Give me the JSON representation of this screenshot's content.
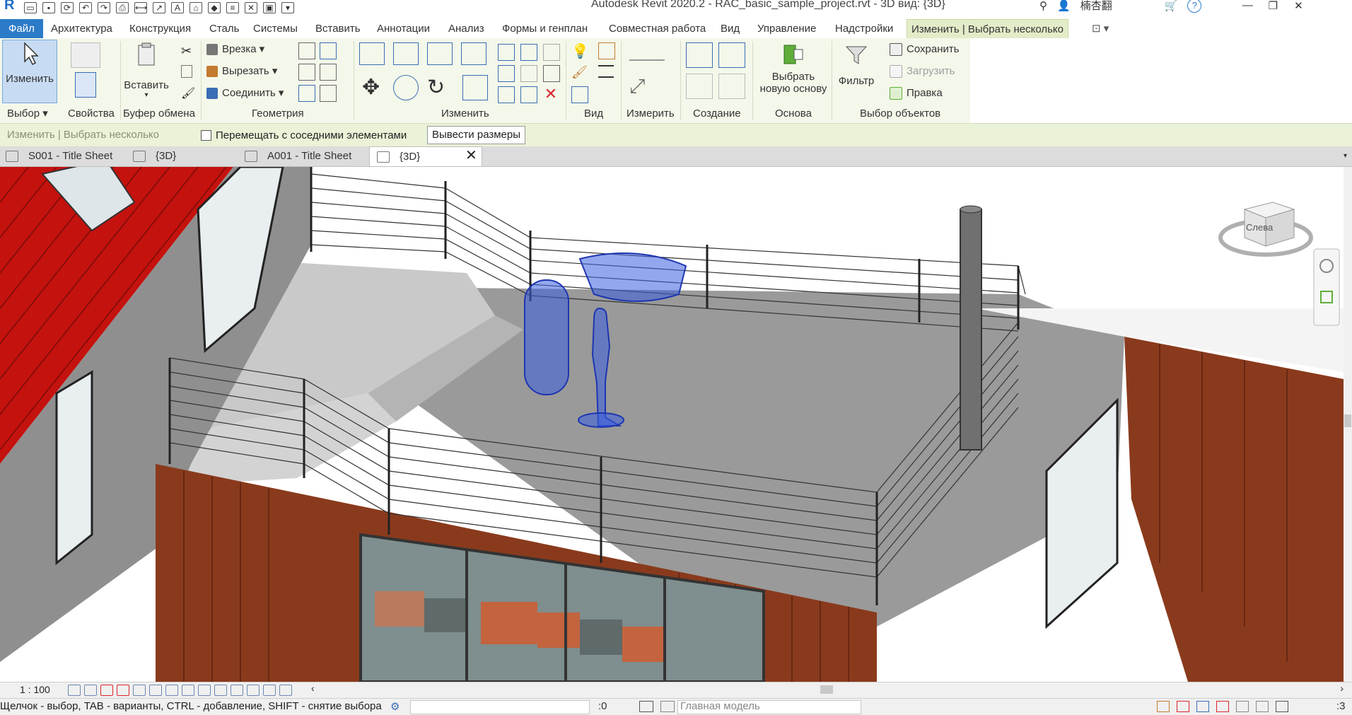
{
  "title_bar": {
    "app_title": "Autodesk Revit 2020.2 - RAC_basic_sample_project.rvt - 3D вид: {3D}",
    "user": "楠杏翻",
    "help": "?"
  },
  "menu": {
    "file": "Файл",
    "tabs": [
      "Архитектура",
      "Конструкция",
      "Сталь",
      "Системы",
      "Вставить",
      "Аннотации",
      "Анализ",
      "Формы и генплан",
      "Совместная работа",
      "Вид",
      "Управление",
      "Надстройки"
    ],
    "active_context_tab": "Изменить | Выбрать несколько"
  },
  "ribbon": {
    "modify_button": "Изменить",
    "panels": [
      "Выбор",
      "Свойства",
      "Буфер обмена",
      "Геометрия",
      "Изменить",
      "Вид",
      "Измерить",
      "Создание",
      "Основа",
      "Выбор объектов"
    ],
    "clipboard_paste": "Вставить",
    "geometry": {
      "cope": "Врезка",
      "cut": "Вырезать",
      "join": "Соединить"
    },
    "host": {
      "line1": "Выбрать",
      "line2": "новую основу"
    },
    "filter": "Фильтр",
    "selection": {
      "save": "Сохранить",
      "load": "Загрузить",
      "edit": "Правка"
    }
  },
  "options_bar": {
    "context_label": "Изменить | Выбрать несколько",
    "move_with_neighbors": "Перемещать с соседними элементами",
    "move_with_neighbors_checked": false,
    "show_dimensions": "Вывести размеры"
  },
  "view_tabs": [
    {
      "label": "S001 - Title Sheet"
    },
    {
      "label": "{3D}"
    },
    {
      "label": "A001 - Title Sheet"
    },
    {
      "label": "{3D}",
      "active": true
    }
  ],
  "viewcube": {
    "face": "Слева"
  },
  "view_control": {
    "scale": "1 : 100"
  },
  "status_bar": {
    "hint": "Щелчок - выбор, TAB - варианты, CTRL - добавление, SHIFT - снятие выбора",
    "selected_count": ":0",
    "model": "Главная модель",
    "filter_count": ":3"
  },
  "colors": {
    "file_tab": "#2c7bc8",
    "context_tab": "#e2ecc9",
    "roof_red": "#c4120e",
    "siding_brown": "#8a3a1c",
    "selection_blue": "#3a5ee0"
  }
}
